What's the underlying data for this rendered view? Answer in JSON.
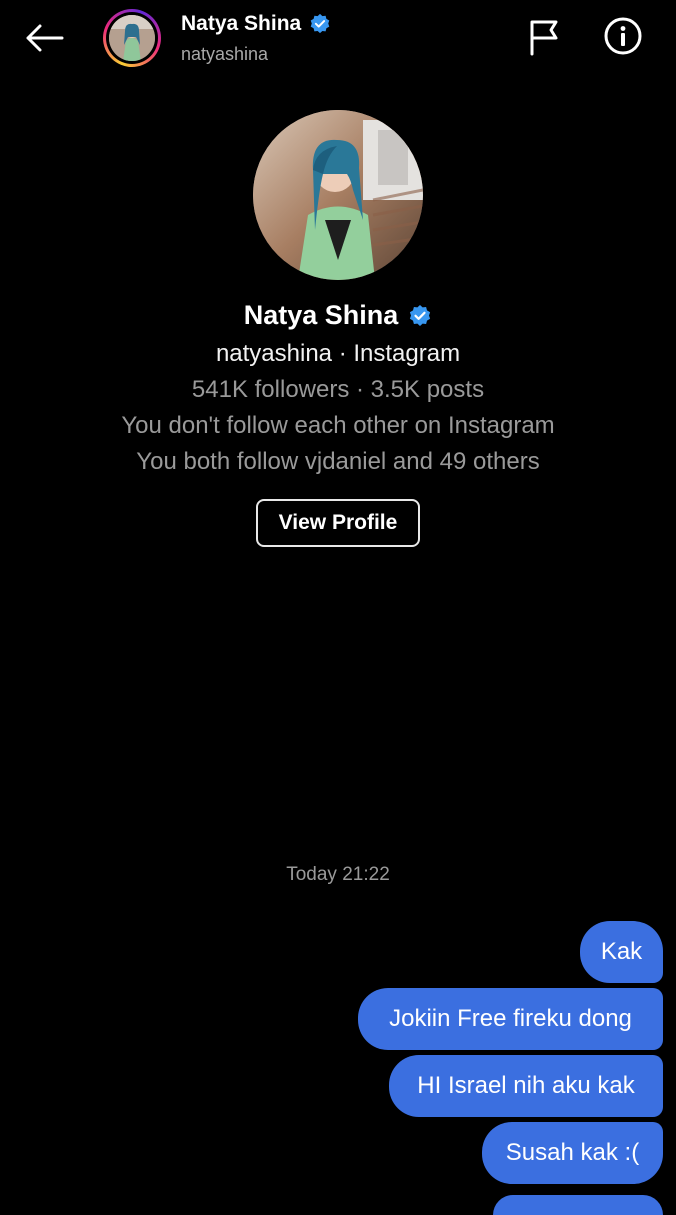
{
  "header": {
    "name": "Natya Shina",
    "handle": "natyashina",
    "icons": {
      "back": "arrow-left-icon",
      "flag": "flag-icon",
      "info": "info-icon",
      "verified": "verified-badge-icon"
    }
  },
  "profile": {
    "name": "Natya Shina",
    "handle_line": "natyashina · Instagram",
    "stats_line": "541K followers · 3.5K posts",
    "follow_line": "You don't follow each other on Instagram",
    "mutual_line": "You both follow vjdaniel and 49 others",
    "view_profile_label": "View Profile"
  },
  "chat": {
    "timestamp": "Today 21:22",
    "messages": [
      {
        "text": "Kak",
        "from": "me"
      },
      {
        "text": "Jokiin Free fireku dong",
        "from": "me"
      },
      {
        "text": "HI Israel nih aku kak",
        "from": "me"
      },
      {
        "text": "Susah kak :(",
        "from": "me"
      },
      {
        "text": "",
        "from": "me"
      }
    ]
  },
  "colors": {
    "background": "#000000",
    "bubble": "#3b6fe0",
    "verified": "#3897f0",
    "secondary_text": "#9a9a9a"
  }
}
